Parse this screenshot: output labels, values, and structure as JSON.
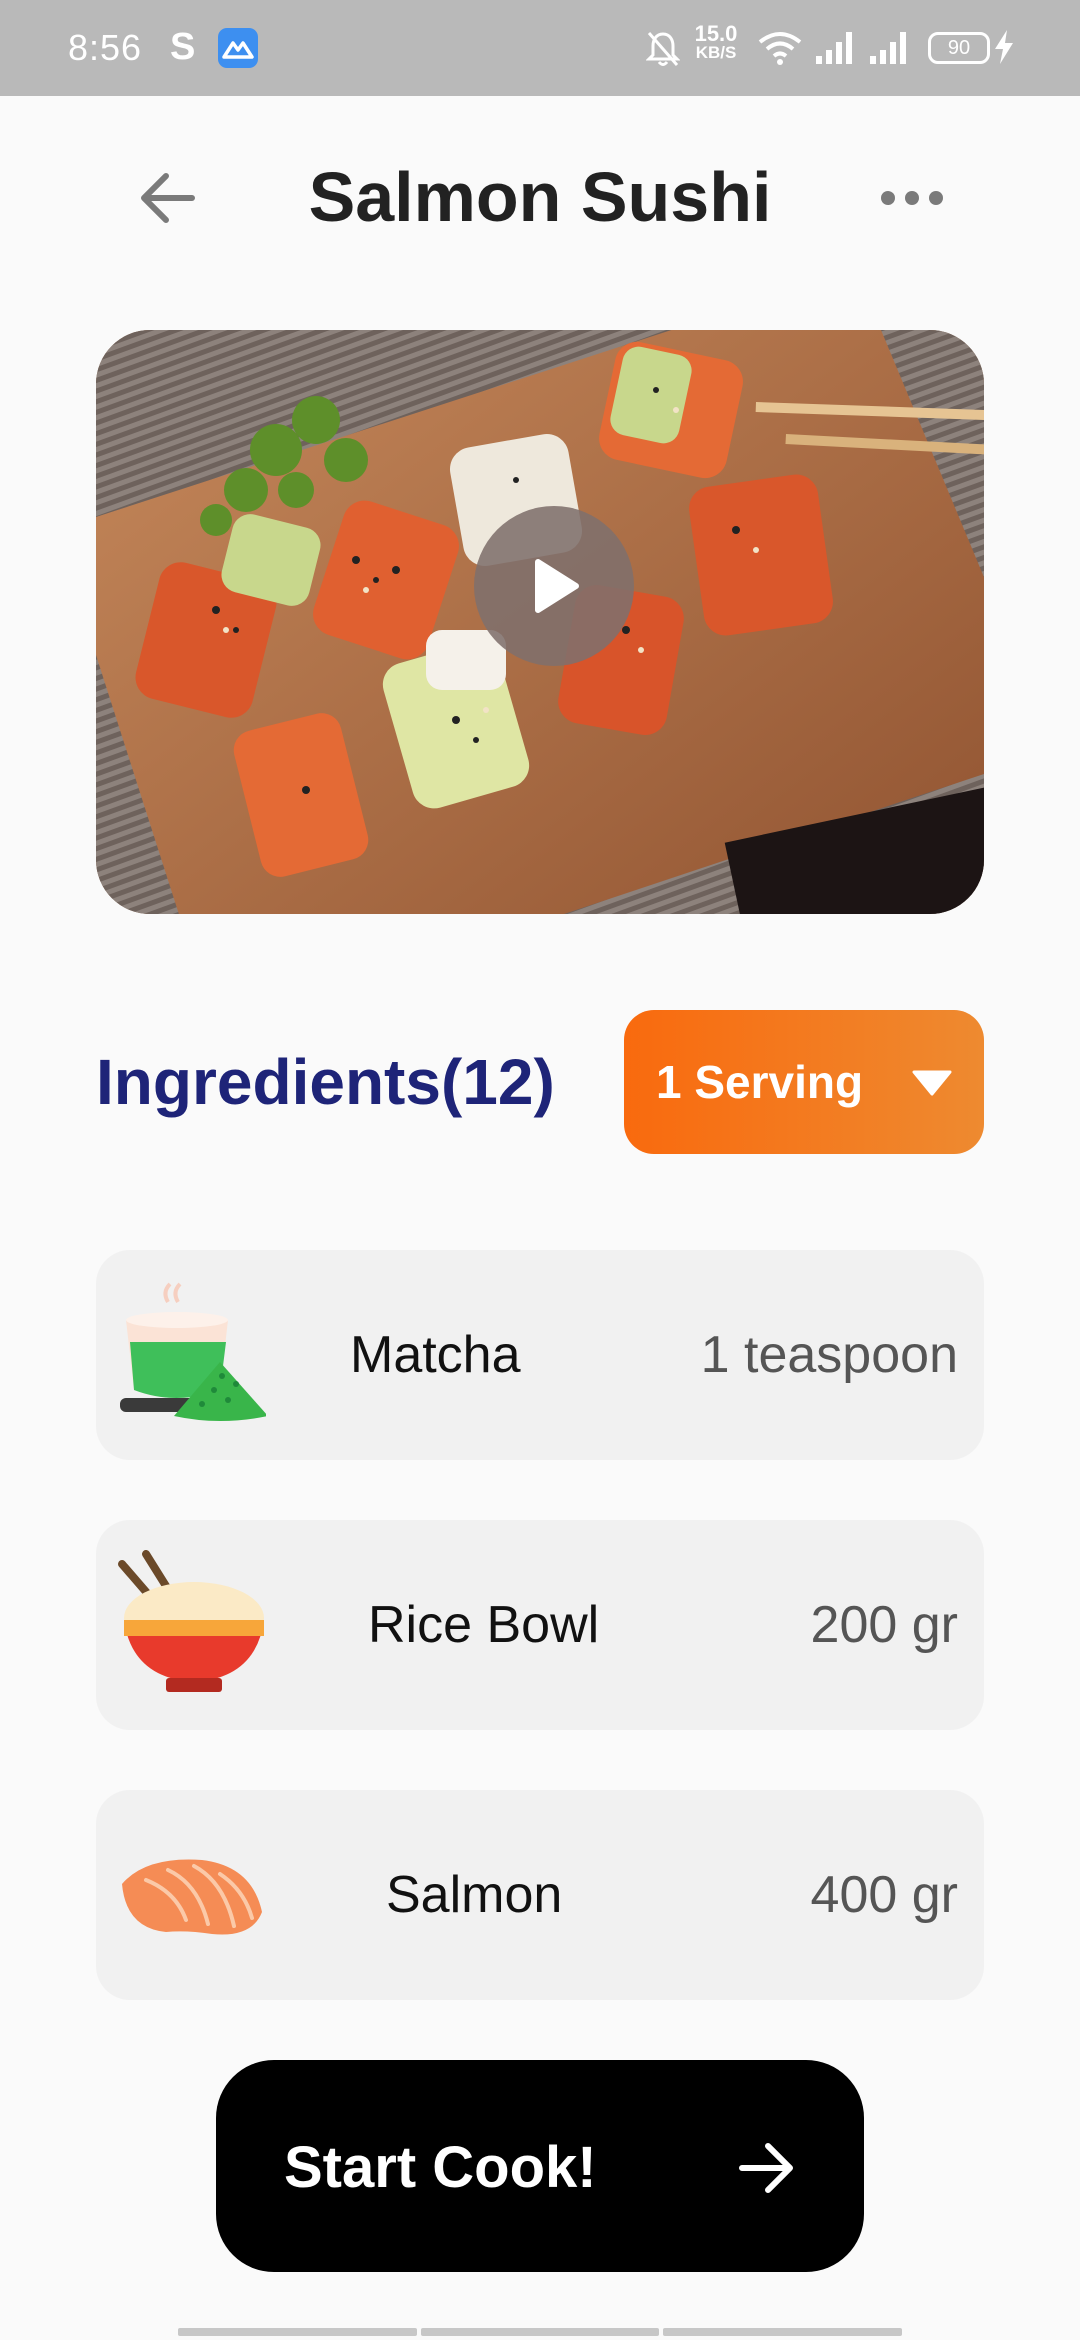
{
  "status_bar": {
    "time": "8:56",
    "app_letter": "S",
    "net_speed": "15.0",
    "net_unit": "KB/S",
    "battery": "90",
    "icons": [
      "s-app-icon",
      "mountain-app-icon",
      "bell-muted-icon",
      "wifi-icon",
      "signal-icon",
      "signal-icon",
      "battery-icon",
      "charging-bolt-icon"
    ]
  },
  "header": {
    "title": "Salmon Sushi",
    "back_icon": "arrow-left-icon",
    "more_icon": "more-horizontal-icon"
  },
  "media": {
    "play_icon": "play-icon"
  },
  "ingredients": {
    "title": "Ingredients(12)",
    "serving": {
      "label": "1 Serving",
      "icon": "chevron-down-icon",
      "gradient": [
        "#f96a0e",
        "#ee8a30"
      ]
    },
    "items": [
      {
        "name": "Matcha",
        "quantity": "1 teaspoon",
        "icon": "matcha-icon"
      },
      {
        "name": "Rice Bowl",
        "quantity": "200 gr",
        "icon": "rice-bowl-icon"
      },
      {
        "name": "Salmon",
        "quantity": "400 gr",
        "icon": "salmon-icon"
      }
    ]
  },
  "cta": {
    "label": "Start Cook!",
    "icon": "arrow-right-icon"
  },
  "colors": {
    "title_text": "#222222",
    "ingredients_title": "#1e2478",
    "card_background": "#f1f1f1",
    "cta_background": "#000000"
  }
}
